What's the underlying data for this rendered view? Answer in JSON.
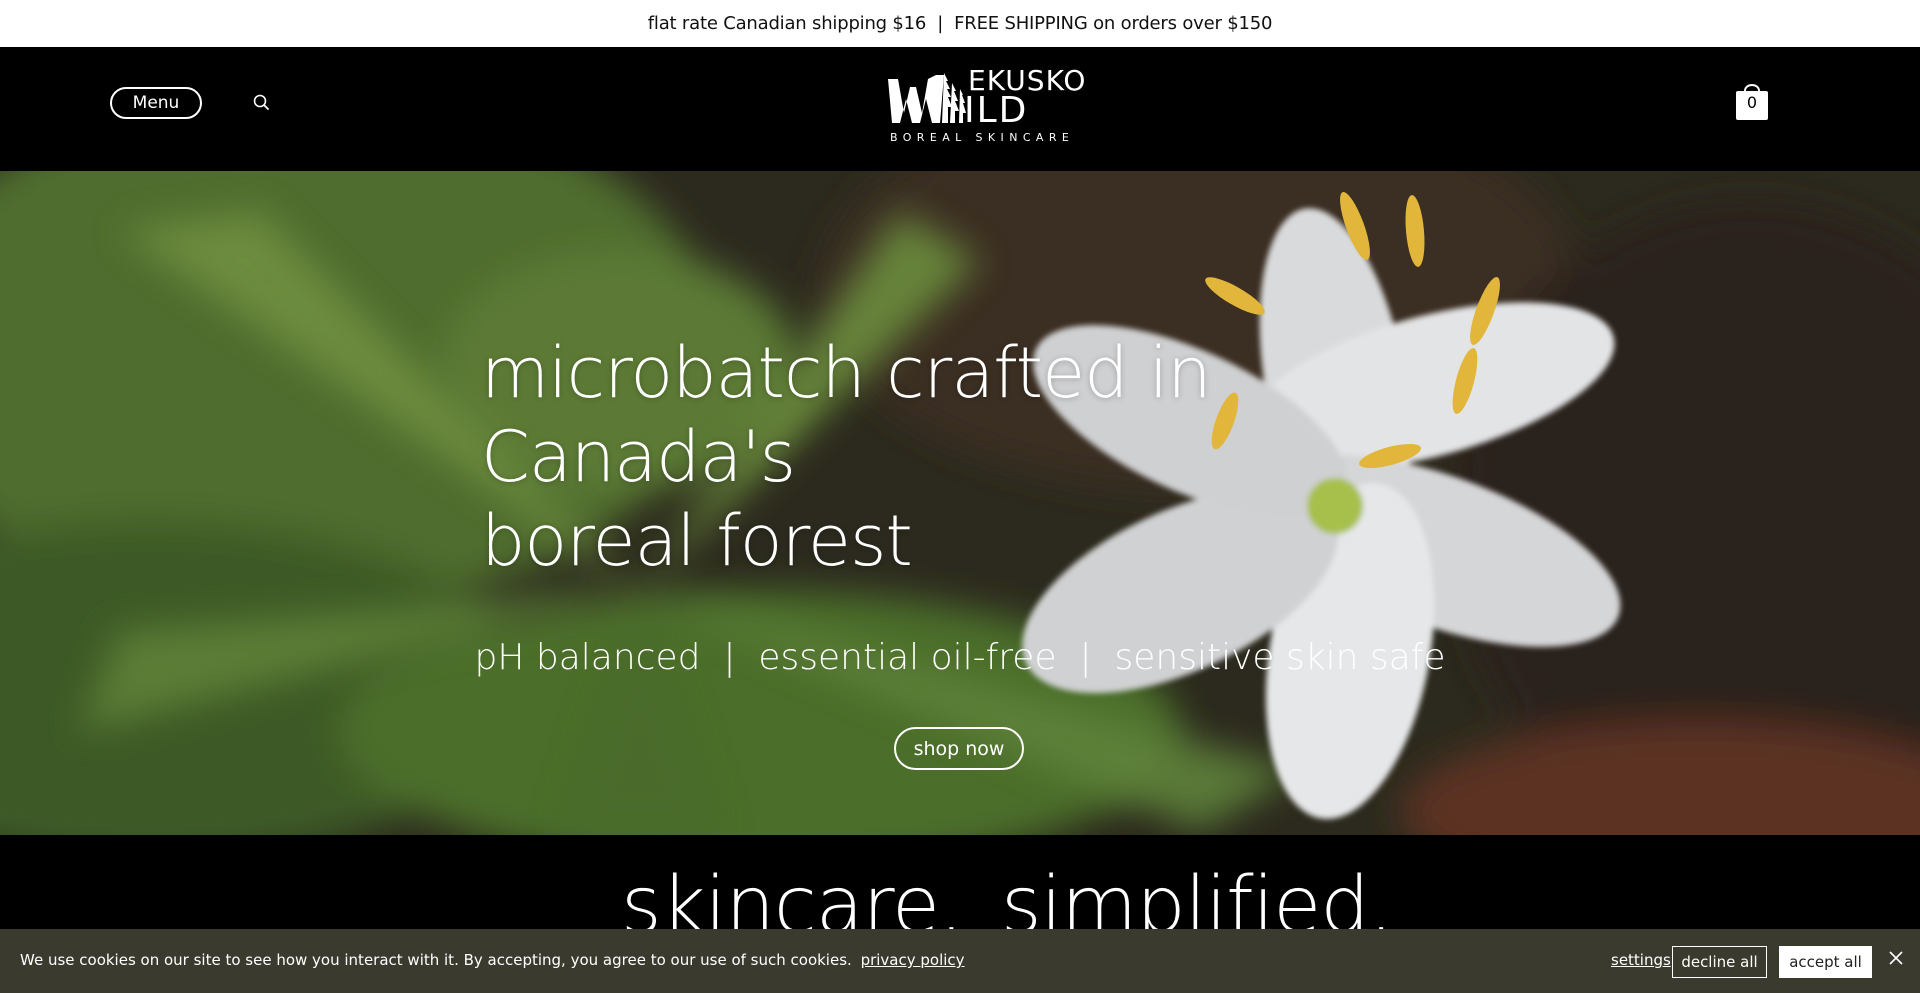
{
  "announcement": {
    "text": "flat rate Canadian shipping $16  |  FREE SHIPPING on orders over $150"
  },
  "header": {
    "menu_label": "Menu",
    "logo": {
      "line1": "EKUSKO",
      "line2": "ILD",
      "tagline": "BOREAL SKINCARE"
    },
    "cart_count": "0"
  },
  "hero": {
    "title_line1": "microbatch crafted in Canada's",
    "title_line2": "boreal forest",
    "subtitle": "pH balanced  |  essential oil-free  |  sensitive skin safe",
    "cta_label": "shop now"
  },
  "section2": {
    "word1": "skincare.",
    "word2": "simplified."
  },
  "cookie": {
    "message": "We use cookies on our site to see how you interact with it. By accepting, you agree to our use of such cookies.",
    "policy_link": "privacy policy",
    "settings_label": "settings",
    "decline_label": "decline all",
    "accept_label": "accept all"
  }
}
